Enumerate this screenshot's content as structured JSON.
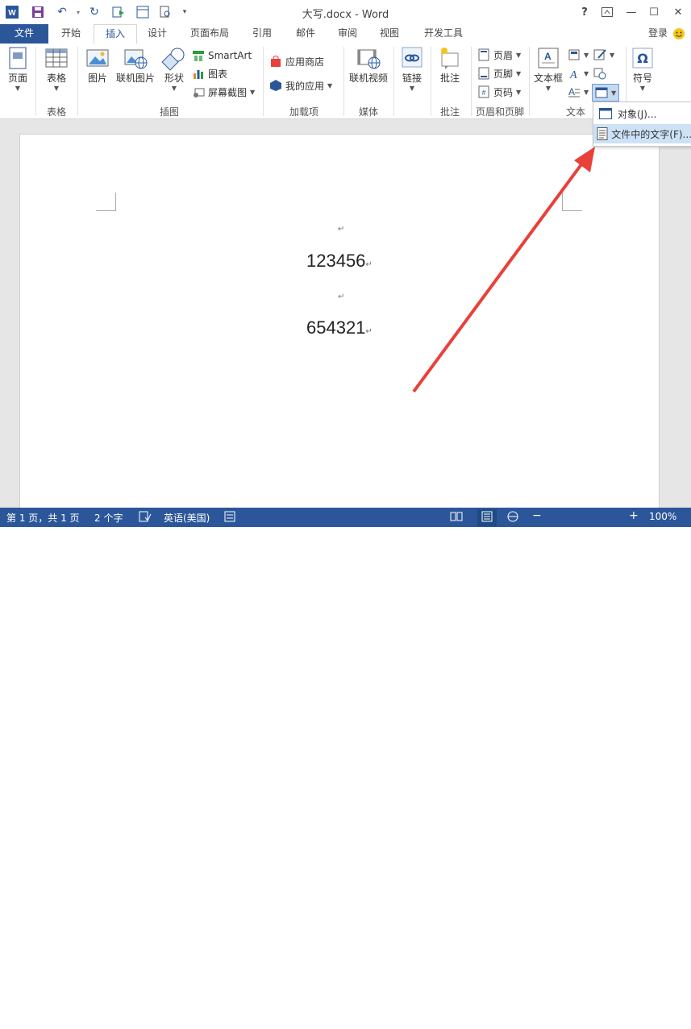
{
  "app": {
    "title": "大写.docx - Word",
    "help": "?",
    "minimize": "—",
    "maximize": "☐",
    "close": "✕"
  },
  "tabs": [
    "文件",
    "开始",
    "插入",
    "设计",
    "页面布局",
    "引用",
    "邮件",
    "审阅",
    "视图",
    "开发工具"
  ],
  "account": "登录",
  "ribbon": {
    "page_btn": "页面",
    "table_btn": "表格",
    "table_group": "表格",
    "picture_btn": "图片",
    "online_picture_btn": "联机图片",
    "shapes_btn": "形状",
    "smartart": "SmartArt",
    "chart": "图表",
    "screenshot": "屏幕截图",
    "illustrations_group": "插图",
    "store": "应用商店",
    "my_apps": "我的应用",
    "addins_group": "加载项",
    "online_video_btn": "联机视频",
    "media_group": "媒体",
    "link_btn": "链接",
    "comment_btn": "批注",
    "comments_group": "批注",
    "header": "页眉",
    "footer": "页脚",
    "page_number": "页码",
    "header_footer_group": "页眉和页脚",
    "textbox_btn": "文本框",
    "text_group": "文本",
    "symbol_btn": "符号"
  },
  "object_menu": {
    "item_object": "对象(J)...",
    "item_text_from_file": "文件中的文字(F)..."
  },
  "document": {
    "line1": "123456",
    "line2": "654321",
    "para_mark": "↵"
  },
  "status": {
    "page": "第 1 页，共 1 页",
    "words": "2 个字",
    "language": "英语(美国)",
    "zoom": "100%",
    "zoom_minus": "−",
    "zoom_plus": "+"
  },
  "colors": {
    "accent": "#2b579a",
    "arrow": "#e8413a"
  }
}
